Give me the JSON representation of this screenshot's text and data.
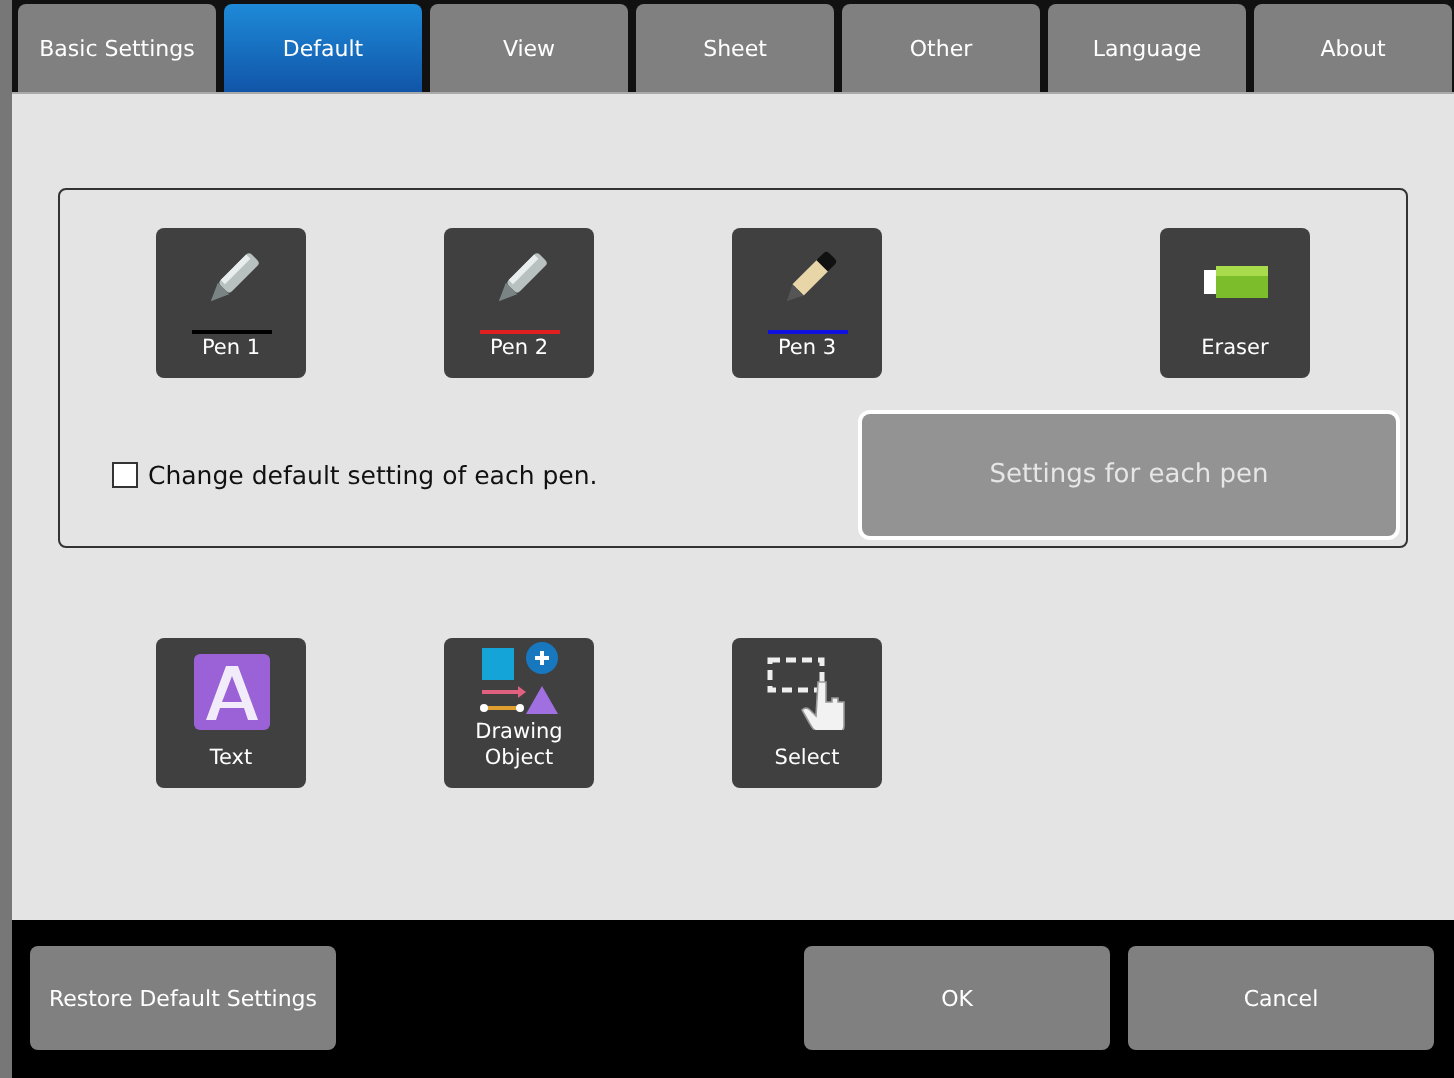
{
  "tabs": [
    {
      "label": "Basic Settings",
      "selected": false
    },
    {
      "label": "Default",
      "selected": true
    },
    {
      "label": "View",
      "selected": false
    },
    {
      "label": "Sheet",
      "selected": false
    },
    {
      "label": "Other",
      "selected": false
    },
    {
      "label": "Language",
      "selected": false
    },
    {
      "label": "About",
      "selected": false
    }
  ],
  "pens_group": {
    "tools": [
      {
        "kind": "pen",
        "label": "Pen 1",
        "color": "#000000"
      },
      {
        "kind": "pen",
        "label": "Pen 2",
        "color": "#e02020"
      },
      {
        "kind": "marker",
        "label": "Pen 3",
        "color": "#1010e0"
      },
      {
        "kind": "eraser",
        "label": "Eraser"
      }
    ],
    "checkbox": {
      "label": "Change default setting of each pen.",
      "checked": false
    },
    "settings_button": {
      "label": "Settings for each pen",
      "disabled": true
    }
  },
  "tools": [
    {
      "kind": "text",
      "label": "Text"
    },
    {
      "kind": "drawing",
      "label": "Drawing Object"
    },
    {
      "kind": "select",
      "label": "Select"
    }
  ],
  "footer": {
    "restore_button": "Restore Default Settings",
    "buttons": [
      "OK",
      "Cancel"
    ]
  }
}
